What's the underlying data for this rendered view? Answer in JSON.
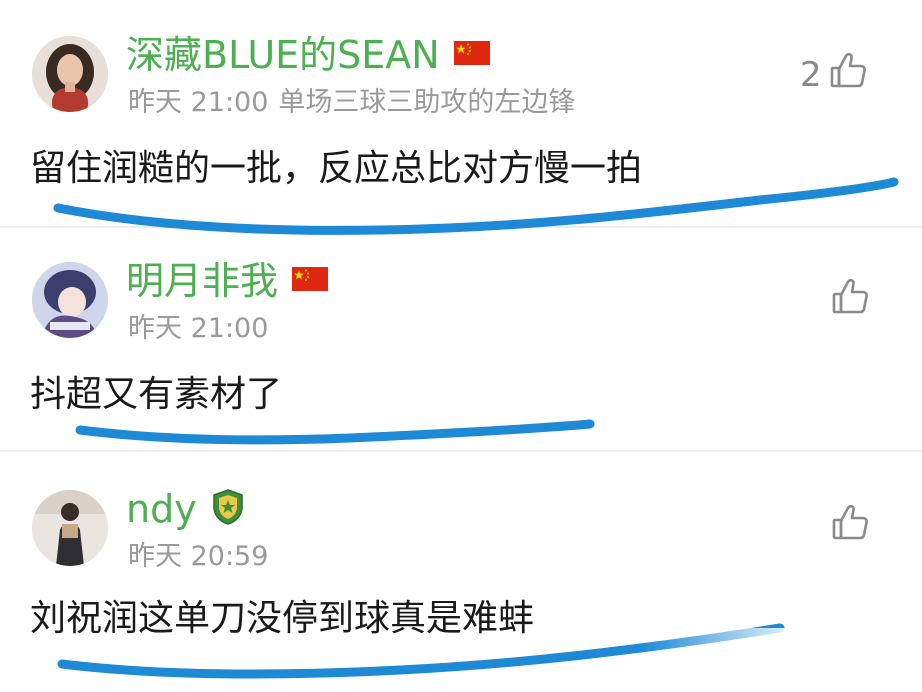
{
  "comments": [
    {
      "username": "深藏BLUE的SEAN",
      "badge": "china-flag-icon",
      "time": "昨天 21:00",
      "subtitle": "单场三球三助攻的左边锋",
      "text": "留住润糙的一批，反应总比对方慢一拍",
      "likes": "2"
    },
    {
      "username": "明月非我",
      "badge": "china-flag-icon",
      "time": "昨天 21:00",
      "subtitle": "",
      "text": "抖超又有素材了",
      "likes": ""
    },
    {
      "username": "ndy",
      "badge": "club-crest-icon",
      "time": "昨天 20:59",
      "subtitle": "",
      "text": "刘祝润这单刀没停到球真是难蚌",
      "likes": ""
    }
  ],
  "colors": {
    "username": "#4caf50",
    "meta": "#9a9a9a",
    "text": "#1a1a1a",
    "underline": "#1e8ad6",
    "flag_red": "#de2910",
    "flag_star": "#ffde00"
  }
}
